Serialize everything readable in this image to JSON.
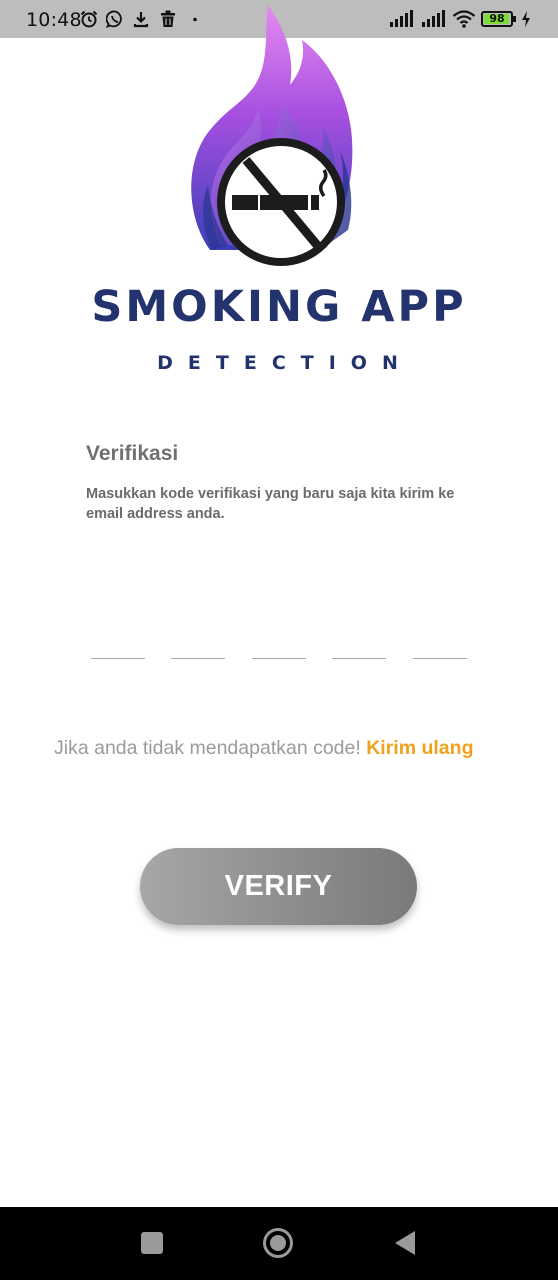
{
  "status_bar": {
    "time": "10:48",
    "battery_level": 98,
    "battery_text": "98",
    "icons": [
      "alarm-icon",
      "whatsapp-icon",
      "download-icon",
      "trash-icon",
      "dot-icon",
      "signal-icon",
      "signal-icon",
      "wifi-icon",
      "battery-icon",
      "charging-icon"
    ]
  },
  "header": {
    "logo_icon": "no-smoking-flame-logo",
    "title": "SMOKING APP",
    "subtitle": "DETECTION",
    "title_color": "#22336e"
  },
  "verification": {
    "title": "Verifikasi",
    "description": "Masukkan kode verifikasi yang baru saja kita kirim ke email address anda.",
    "code_fields": [
      "",
      "",
      "",
      "",
      ""
    ]
  },
  "resend": {
    "text": "Jika anda tidak mendapatkan code! ",
    "link_label": "Kirim ulang",
    "link_color": "#f0a21e"
  },
  "verify_button": {
    "label": "VERIFY"
  },
  "nav_bar": {
    "buttons": [
      "recents-square-icon",
      "home-circle-icon",
      "back-triangle-icon"
    ]
  }
}
